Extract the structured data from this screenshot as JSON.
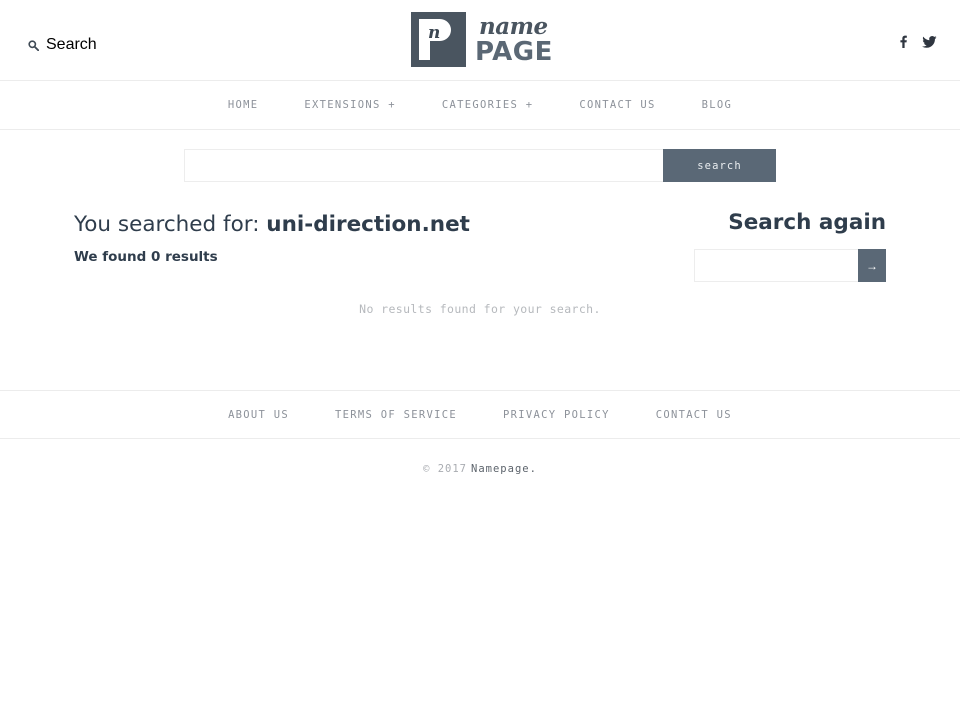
{
  "header": {
    "search_toggle": {
      "icon": "search-icon",
      "label": "Search"
    },
    "logo": {
      "mark_letter": "n",
      "name_text": "name",
      "page_text": "PAGE",
      "mark_color": "#4a5560"
    },
    "social": [
      {
        "name": "facebook-icon",
        "label": "f"
      },
      {
        "name": "twitter-icon",
        "label": "t"
      }
    ]
  },
  "nav": {
    "items": [
      {
        "label": "HOME"
      },
      {
        "label": "EXTENSIONS +"
      },
      {
        "label": "CATEGORIES +"
      },
      {
        "label": "CONTACT US"
      },
      {
        "label": "BLOG"
      }
    ]
  },
  "hero_search": {
    "value": "",
    "placeholder": "",
    "button_label": "search"
  },
  "results": {
    "heading_prefix": "You searched for: ",
    "query_term": "uni-direction.net",
    "found_text": "We found 0 results",
    "empty_message": "No results found for your search."
  },
  "search_again": {
    "title": "Search again",
    "value": "",
    "placeholder": "",
    "button_label": "→"
  },
  "footer": {
    "links": [
      {
        "label": "ABOUT US"
      },
      {
        "label": "TERMS OF SERVICE"
      },
      {
        "label": "PRIVACY POLICY"
      },
      {
        "label": "CONTACT US"
      }
    ],
    "copyright_text": "© 2017",
    "copyright_brand": "Namepage."
  },
  "theme": {
    "accent": "#5a6876",
    "heading": "#2f3d4c",
    "muted": "#8d929a",
    "border": "#ececec"
  }
}
